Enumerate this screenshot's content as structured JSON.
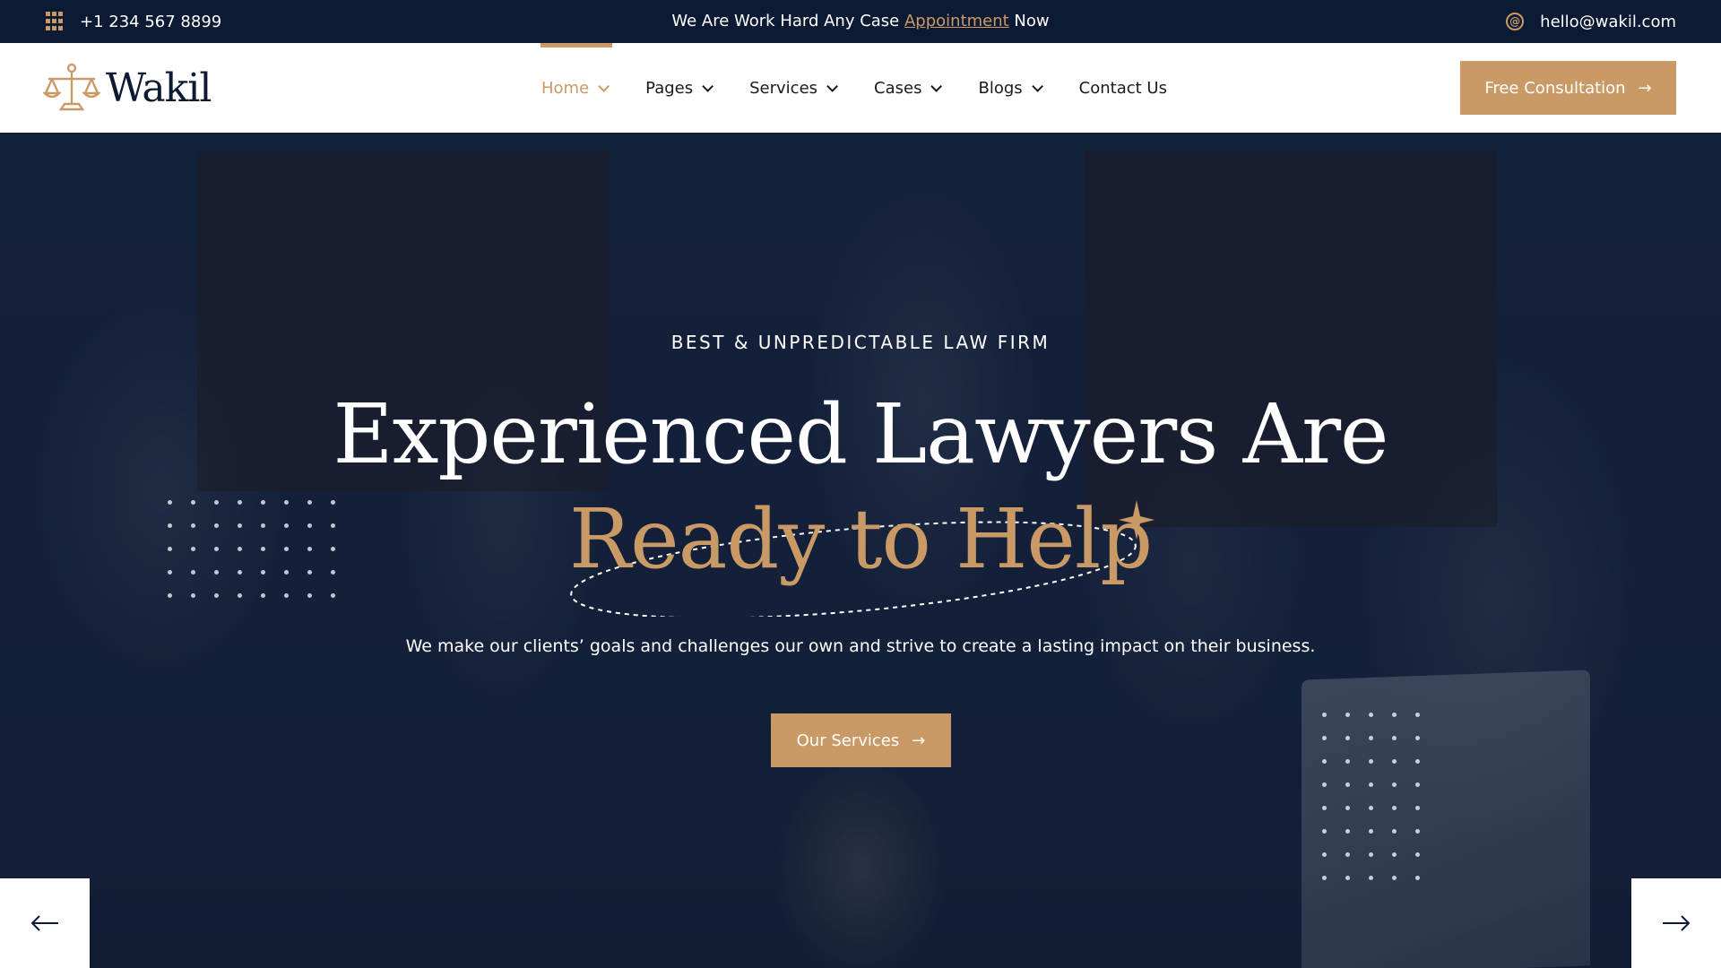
{
  "topbar": {
    "phone": "+1 234 567 8899",
    "notice_before": "We Are Work Hard Any Case ",
    "notice_link": "Appointment",
    "notice_after": " Now",
    "email": "hello@wakil.com"
  },
  "brand": {
    "name": "Wakil",
    "accent": "#c99a66",
    "navy": "#0d1a33"
  },
  "nav": {
    "items": [
      {
        "label": "Home",
        "dropdown": true,
        "active": true
      },
      {
        "label": "Pages",
        "dropdown": true
      },
      {
        "label": "Services",
        "dropdown": true
      },
      {
        "label": "Cases",
        "dropdown": true
      },
      {
        "label": "Blogs",
        "dropdown": true
      },
      {
        "label": "Contact Us",
        "dropdown": false
      }
    ],
    "cta_label": "Free Consultation"
  },
  "hero": {
    "subtitle": "BEST & UNPREDICTABLE LAW FIRM",
    "headline_line1": "Experienced Lawyers Are",
    "headline_line2": "Ready to Help",
    "description": "We make our clients’ goals and challenges our own and strive to create a lasting impact on their business.",
    "button_label": "Our Services"
  },
  "icons": {
    "phone": "dialpad-icon",
    "email": "at-sign-icon",
    "prev": "arrow-left-icon",
    "next": "arrow-right-icon"
  }
}
